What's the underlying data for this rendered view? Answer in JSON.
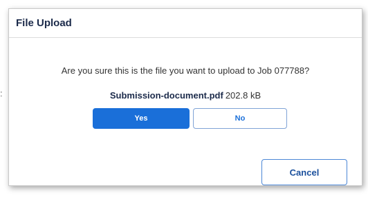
{
  "dialog": {
    "title": "File Upload",
    "question": "Are you sure this is the file you want to upload to Job 077788?",
    "file_name": "Submission-document.pdf",
    "file_size": "202.8 kB",
    "yes_label": "Yes",
    "no_label": "No",
    "cancel_label": "Cancel"
  },
  "colors": {
    "primary": "#1a6fd9",
    "title_text": "#1b2a4a"
  }
}
